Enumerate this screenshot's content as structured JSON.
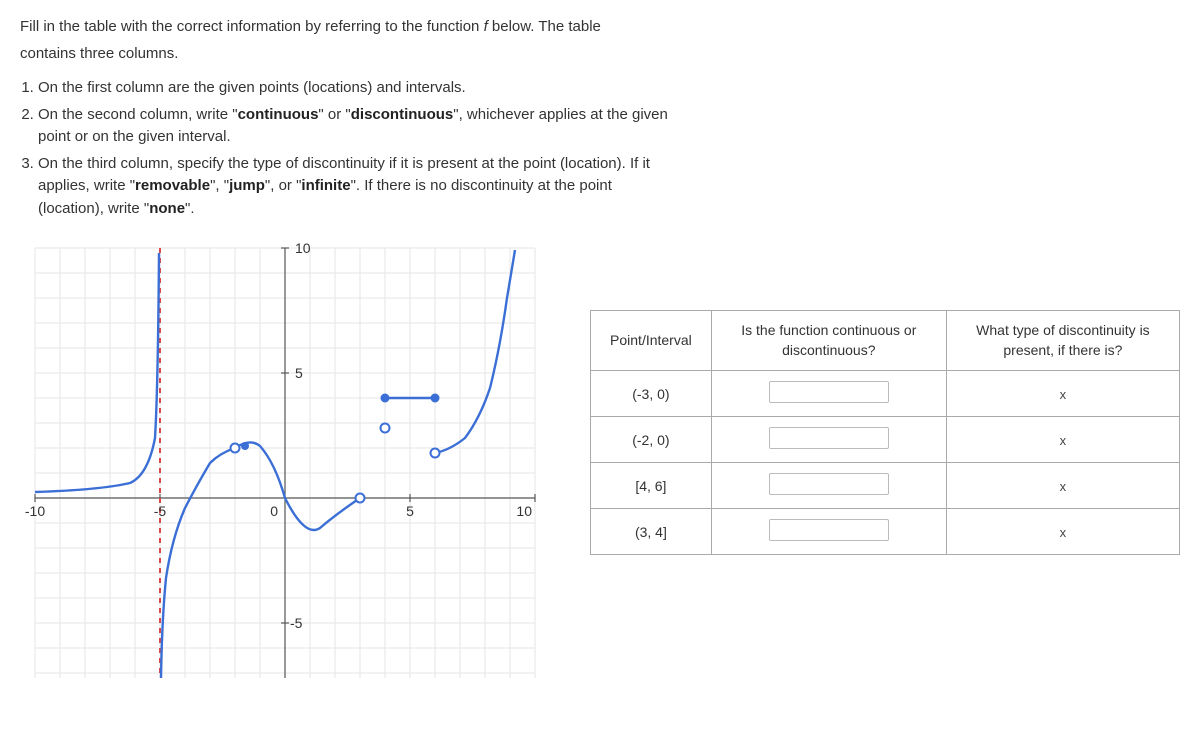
{
  "intro": {
    "line1a": "Fill in the table with the correct information by referring to the function ",
    "line1b": " below. The table",
    "line2": "contains three columns.",
    "fname": "f"
  },
  "instructions": {
    "i1": "On the first column are the given points (locations) and intervals.",
    "i2a": "On the second column, write \"",
    "i2b": "\" or \"",
    "i2c": "\", whichever applies at the given",
    "i2d": "point or on the given interval.",
    "continuous": "continuous",
    "discontinuous": "discontinuous",
    "i3a": "On the third column, specify the type of discontinuity if it is present at the point (location). If it",
    "i3b": "applies, write \"",
    "i3c": "\", \"",
    "i3d": "\", or \"",
    "i3e": "\". If there is no discontinuity at the point",
    "i3f": "(location), write \"",
    "i3g": "\".",
    "removable": "removable",
    "jump": "jump",
    "infinite": "infinite",
    "none": "none"
  },
  "table": {
    "header1": "Point/Interval",
    "header2a": "Is the function continuous or",
    "header2b": "discontinuous?",
    "header3a": "What type of discontinuity is",
    "header3b": "present, if there is?",
    "rows": [
      {
        "point": "(-3, 0)",
        "x": "x"
      },
      {
        "point": "(-2, 0)",
        "x": "x"
      },
      {
        "point": "[4, 6]",
        "x": "x"
      },
      {
        "point": "(3, 4]",
        "x": "x"
      }
    ]
  },
  "axis": {
    "xneg10": "-10",
    "xneg5": "-5",
    "x0": "0",
    "x5": "5",
    "x10": "10",
    "y10": "10",
    "y5": "5",
    "yneg5": "-5"
  }
}
